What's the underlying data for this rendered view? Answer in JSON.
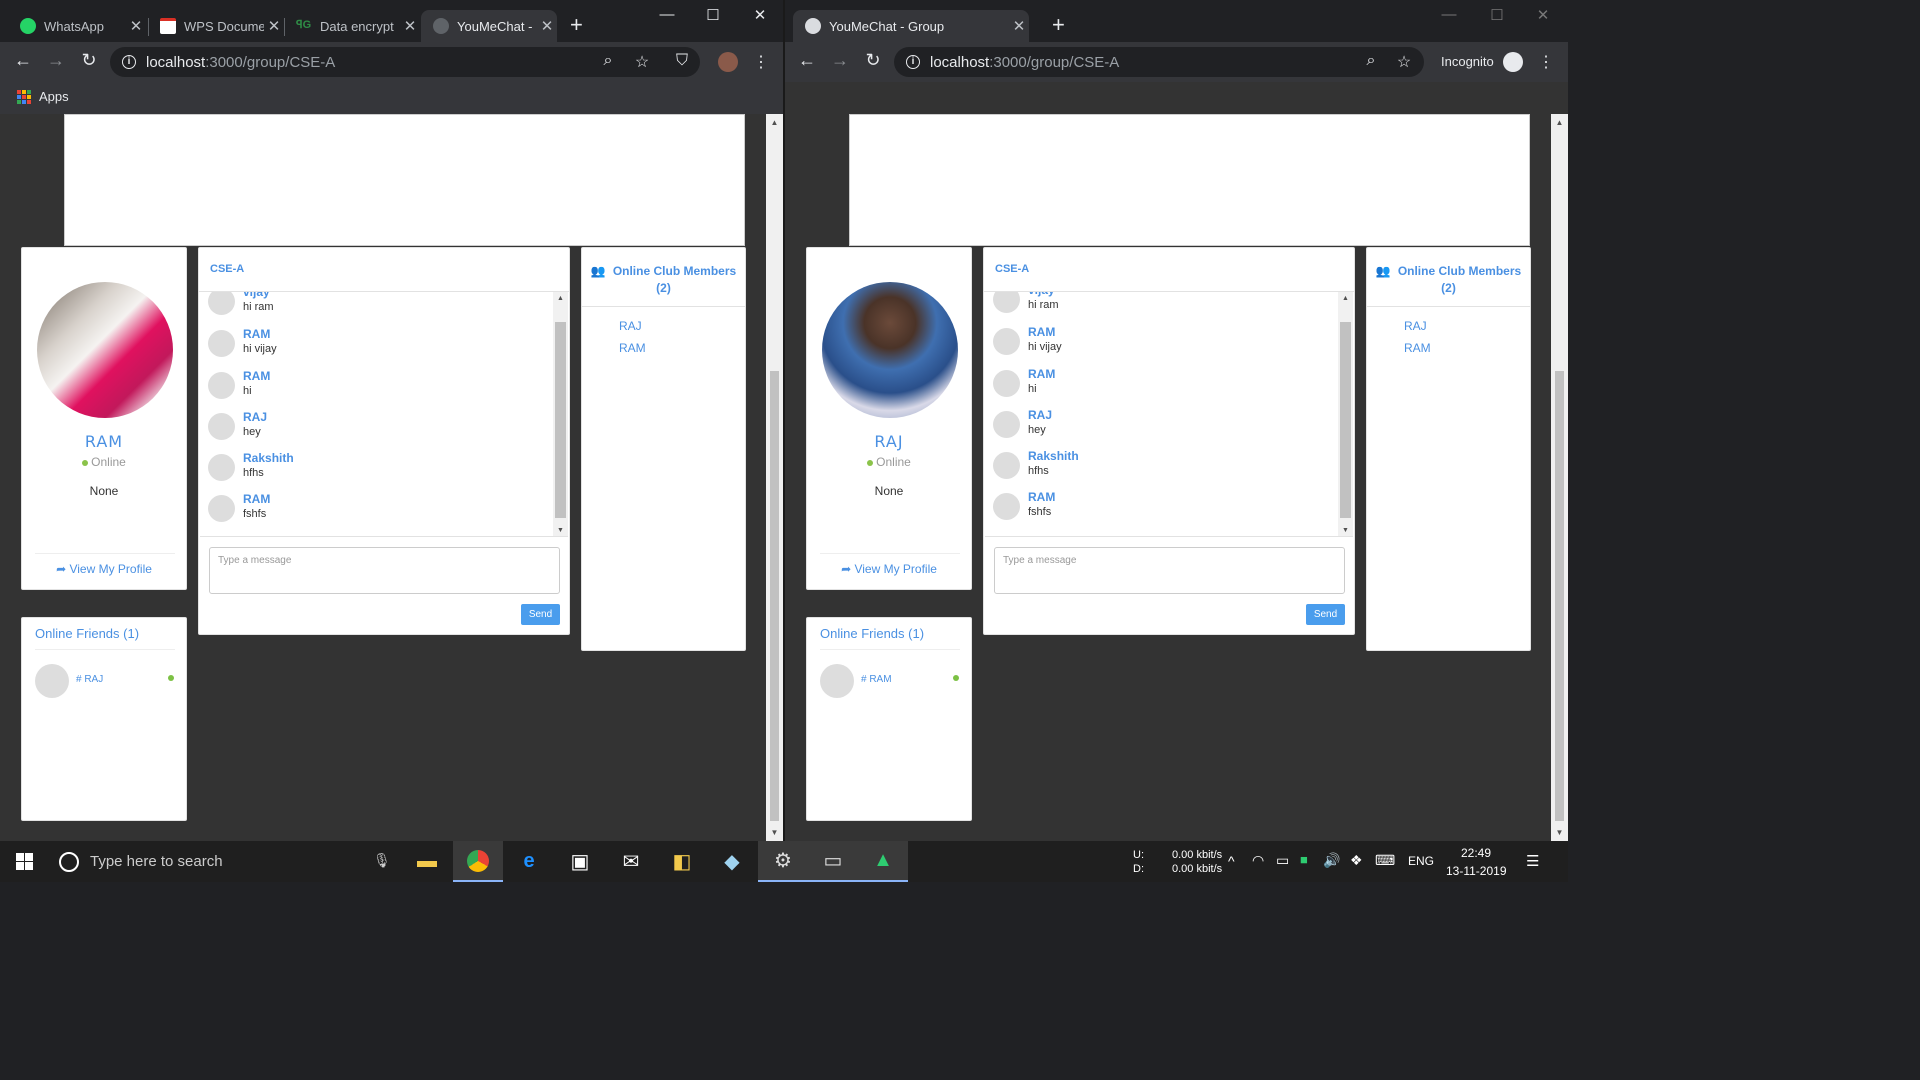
{
  "left_window": {
    "tabs": [
      {
        "title": "WhatsApp",
        "icon": "whatsapp-icon"
      },
      {
        "title": "WPS Docume",
        "icon": "gmail-icon"
      },
      {
        "title": "Data encrypt",
        "icon": "gfg-icon"
      },
      {
        "title": "YouMeChat -",
        "icon": "globe-icon"
      }
    ],
    "url_host": "localhost",
    "url_path": ":3000/group/CSE-A",
    "bookmark_apps": "Apps",
    "profile": {
      "name": "RAM",
      "status": "Online",
      "about": "None",
      "view_profile": "View My Profile"
    },
    "friends": {
      "title": "Online Friends (1)",
      "items": [
        {
          "name": "# RAJ"
        }
      ]
    },
    "chat": {
      "group": "CSE-A",
      "messages": [
        {
          "name": "vijay",
          "text": "hi ram"
        },
        {
          "name": "RAM",
          "text": "hi vijay"
        },
        {
          "name": "RAM",
          "text": "hi"
        },
        {
          "name": "RAJ",
          "text": "hey"
        },
        {
          "name": "Rakshith",
          "text": "hfhs"
        },
        {
          "name": "RAM",
          "text": "fshfs"
        }
      ],
      "placeholder": "Type a message",
      "send": "Send"
    },
    "members": {
      "title": "Online Club Members (2)",
      "items": [
        "RAJ",
        "RAM"
      ]
    }
  },
  "right_window": {
    "tabs": [
      {
        "title": "YouMeChat - Group",
        "icon": "globe-icon"
      }
    ],
    "url_host": "localhost",
    "url_path": ":3000/group/CSE-A",
    "incognito": "Incognito",
    "profile": {
      "name": "RAJ",
      "status": "Online",
      "about": "None",
      "view_profile": "View My Profile"
    },
    "friends": {
      "title": "Online Friends (1)",
      "items": [
        {
          "name": "# RAM"
        }
      ]
    },
    "chat": {
      "group": "CSE-A",
      "messages": [
        {
          "name": "vijay",
          "text": "hi ram"
        },
        {
          "name": "RAM",
          "text": "hi vijay"
        },
        {
          "name": "RAM",
          "text": "hi"
        },
        {
          "name": "RAJ",
          "text": "hey"
        },
        {
          "name": "Rakshith",
          "text": "hfhs"
        },
        {
          "name": "RAM",
          "text": "fshfs"
        }
      ],
      "placeholder": "Type a message",
      "send": "Send"
    },
    "members": {
      "title": "Online Club Members (2)",
      "items": [
        "RAJ",
        "RAM"
      ]
    }
  },
  "taskbar": {
    "search_placeholder": "Type here to search",
    "upload_label": "U:",
    "download_label": "D:",
    "upload_speed": "0.00 kbit/s",
    "download_speed": "0.00 kbit/s",
    "language": "ENG",
    "time": "22:49",
    "date": "13-11-2019"
  },
  "colors": {
    "accent": "#4a90e2",
    "online": "#8bc34a",
    "send_button": "#4a9ded"
  }
}
